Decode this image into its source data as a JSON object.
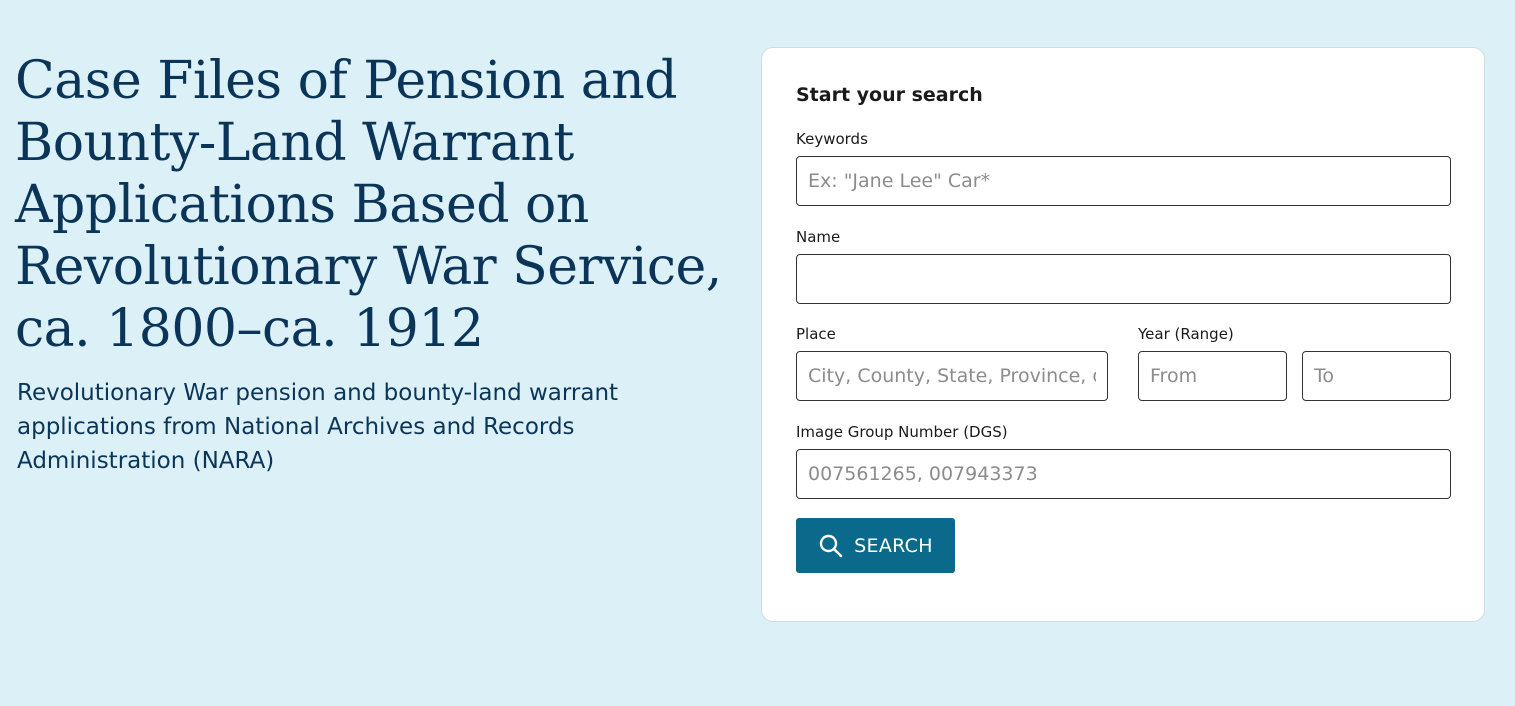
{
  "hero": {
    "title": "Case Files of Pension and Bounty-Land Warrant Applications Based on Revolutionary War Service, ca. 1800–ca. 1912",
    "subtitle": "Revolutionary War pension and bounty-land warrant applications from National Archives and Records Administration (NARA)"
  },
  "search_form": {
    "heading": "Start your search",
    "keywords": {
      "label": "Keywords",
      "placeholder": "Ex: \"Jane Lee\" Car*",
      "value": ""
    },
    "name": {
      "label": "Name",
      "placeholder": "",
      "value": ""
    },
    "place": {
      "label": "Place",
      "placeholder": "City, County, State, Province, or Country",
      "value": ""
    },
    "year_range": {
      "label": "Year (Range)",
      "from_placeholder": "From",
      "to_placeholder": "To"
    },
    "image_group_number": {
      "label": "Image Group Number (DGS)",
      "placeholder": "007561265, 007943373",
      "value": ""
    },
    "search_button": {
      "label": "SEARCH",
      "icon": "search-icon"
    }
  },
  "colors": {
    "page_background": "#dcf0f7",
    "title_text": "#0b3558",
    "button_background": "#0b6a8c",
    "card_background": "#ffffff"
  }
}
